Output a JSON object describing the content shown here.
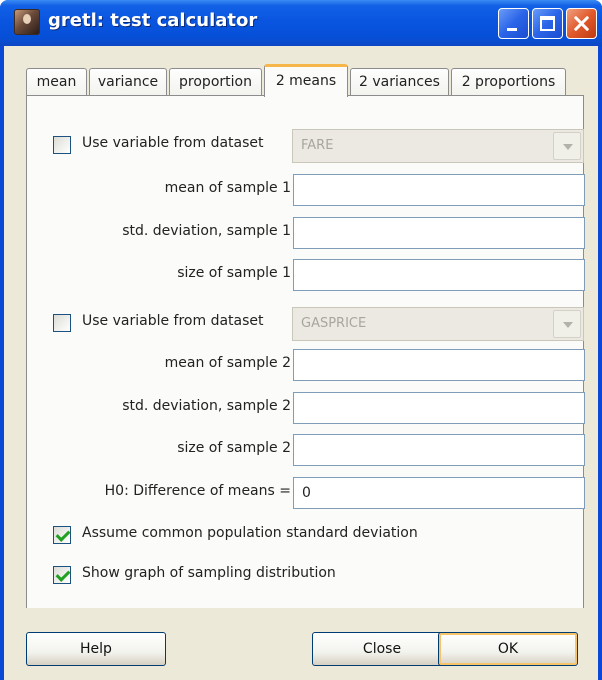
{
  "window": {
    "title": "gretl: test calculator"
  },
  "tabs": [
    {
      "label": "mean"
    },
    {
      "label": "variance"
    },
    {
      "label": "proportion"
    },
    {
      "label": "2 means",
      "active": true
    },
    {
      "label": "2 variances"
    },
    {
      "label": "2 proportions"
    }
  ],
  "sample1": {
    "use_dataset_label": "Use variable from dataset",
    "use_dataset_checked": false,
    "dataset_variable": "FARE",
    "mean_label": "mean of sample 1",
    "mean_value": "",
    "sd_label": "std. deviation, sample 1",
    "sd_value": "",
    "size_label": "size of sample 1",
    "size_value": ""
  },
  "sample2": {
    "use_dataset_label": "Use variable from dataset",
    "use_dataset_checked": false,
    "dataset_variable": "GASPRICE",
    "mean_label": "mean of sample 2",
    "mean_value": "",
    "sd_label": "std. deviation, sample 2",
    "sd_value": "",
    "size_label": "size of sample 2",
    "size_value": ""
  },
  "h0": {
    "label": "H0: Difference of means =",
    "value": "0"
  },
  "options": {
    "common_sd_label": "Assume common population standard deviation",
    "common_sd_checked": true,
    "show_graph_label": "Show graph of sampling distribution",
    "show_graph_checked": true
  },
  "buttons": {
    "help": "Help",
    "close": "Close",
    "ok": "OK"
  }
}
